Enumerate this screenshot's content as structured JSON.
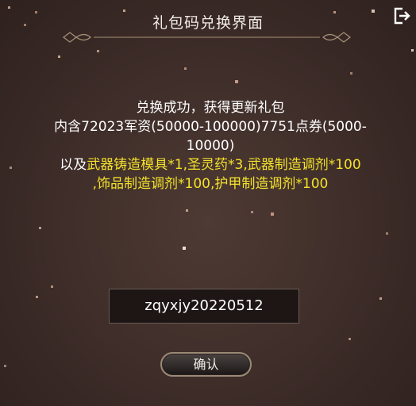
{
  "dialog": {
    "title": "礼包码兑换界面",
    "message_line1": "兑换成功，获得更新礼包",
    "message_line2": "内含72023军资(50000-100000)7751点券(5000-",
    "message_line3": "10000)",
    "message_line4_prefix": "以及",
    "message_line4_highlight": "武器铸造模具*1,圣灵药*3,武器制造调剂*100",
    "message_line5_highlight": ",饰品制造调剂*100,护甲制造调剂*100",
    "code_value": "zqyxjy20220512",
    "confirm_label": "确认"
  },
  "colors": {
    "highlight": "#f3e22a",
    "background": "#3d2c28",
    "button_border": "#9b8b76"
  },
  "icons": {
    "exit": "exit-icon"
  }
}
